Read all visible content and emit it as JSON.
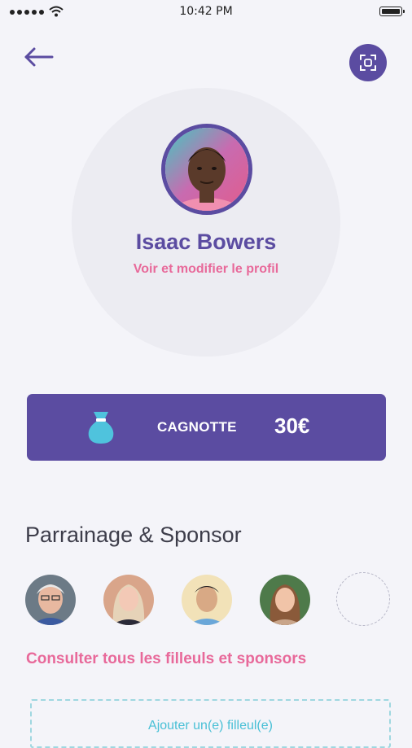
{
  "status_bar": {
    "time": "10:42 PM"
  },
  "header": {
    "back_icon": "arrow-left-icon",
    "scan_icon": "scan-qr-icon"
  },
  "profile": {
    "name": "Isaac Bowers",
    "edit_link": "Voir et modifier le profil",
    "avatar_icon": "user-avatar"
  },
  "cagnotte": {
    "label": "CAGNOTTE",
    "amount": "30€",
    "icon": "money-bag-icon"
  },
  "sponsorship": {
    "title": "Parrainage & Sponsor",
    "people": [
      {
        "name": "person-1"
      },
      {
        "name": "person-2"
      },
      {
        "name": "person-3"
      },
      {
        "name": "person-4"
      }
    ],
    "consult_link": "Consulter tous les filleuls et sponsors",
    "add_label": "Ajouter un(e) filleul(e)"
  },
  "colors": {
    "primary": "#5b4ca1",
    "pink": "#e8699a",
    "teal": "#49c0d6",
    "background": "#f4f4f9"
  }
}
